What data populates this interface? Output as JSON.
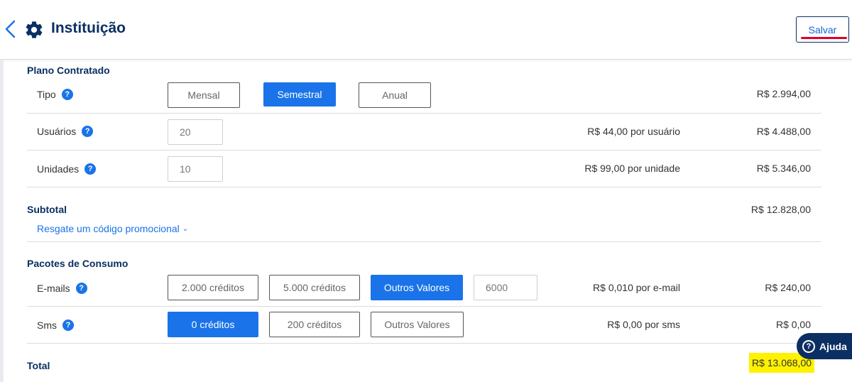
{
  "header": {
    "title": "Instituição",
    "save_label": "Salvar"
  },
  "plano": {
    "title": "Plano Contratado",
    "tipo": {
      "label": "Tipo",
      "options": [
        "Mensal",
        "Semestral",
        "Anual"
      ],
      "selected": "Semestral",
      "amount": "R$ 2.994,00"
    },
    "usuarios": {
      "label": "Usuários",
      "value": "20",
      "unit_price": "R$ 44,00 por usuário",
      "amount": "R$ 4.488,00"
    },
    "unidades": {
      "label": "Unidades",
      "value": "10",
      "unit_price": "R$ 99,00 por unidade",
      "amount": "R$ 5.346,00"
    }
  },
  "subtotal": {
    "label": "Subtotal",
    "amount": "R$ 12.828,00",
    "promo_link": "Resgate um código promocional"
  },
  "pacotes": {
    "title": "Pacotes de Consumo",
    "emails": {
      "label": "E-mails",
      "options": [
        "2.000 créditos",
        "5.000 créditos",
        "Outros Valores"
      ],
      "selected": "Outros Valores",
      "custom_value": "6000",
      "unit_price": "R$ 0,010 por e-mail",
      "amount": "R$ 240,00"
    },
    "sms": {
      "label": "Sms",
      "options": [
        "0 créditos",
        "200 créditos",
        "Outros Valores"
      ],
      "selected": "0 créditos",
      "unit_price": "R$ 0,00 por sms",
      "amount": "R$ 0,00"
    }
  },
  "total": {
    "label": "Total",
    "amount": "R$ 13.068,00"
  },
  "help": {
    "label": "Ajuda"
  },
  "icons": {
    "back": "chevron-left-icon",
    "settings": "gear-icon",
    "help": "question-circle-icon"
  },
  "colors": {
    "accent": "#1a73e8",
    "navy": "#0b2f63",
    "highlight": "#fff200",
    "save_underline": "#e0002a"
  }
}
